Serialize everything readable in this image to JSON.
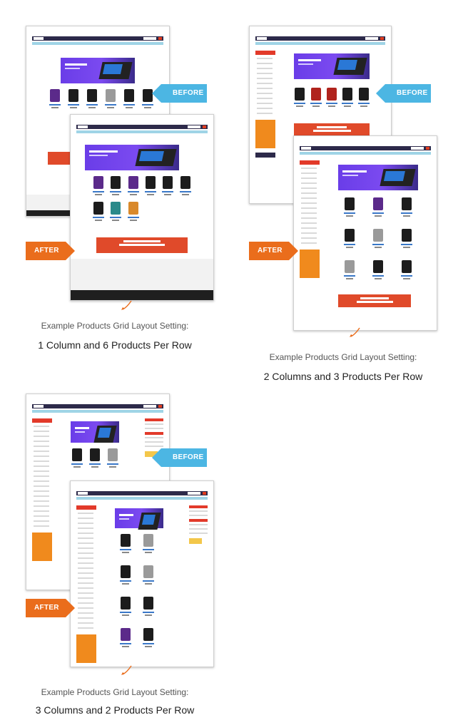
{
  "colors": {
    "before_tag": "#4cb6e3",
    "after_tag": "#ea6d1c",
    "nav": "#2d2a4a",
    "banner": "#6a3de8",
    "event": "#e04a2a"
  },
  "tags": {
    "before": "BEFORE",
    "after": "AFTER"
  },
  "examples": [
    {
      "caption_sub": "Example Products Grid Layout Setting:",
      "caption_main": "1 Column and 6 Products Per Row"
    },
    {
      "caption_sub": "Example Products Grid Layout Setting:",
      "caption_main": "2 Columns and 3 Products Per Row"
    },
    {
      "caption_sub": "Example Products Grid Layout Setting:",
      "caption_main": "3 Columns and 2 Products Per Row"
    }
  ],
  "icons": {
    "arrow": "curved-arrow-down-left-icon"
  }
}
